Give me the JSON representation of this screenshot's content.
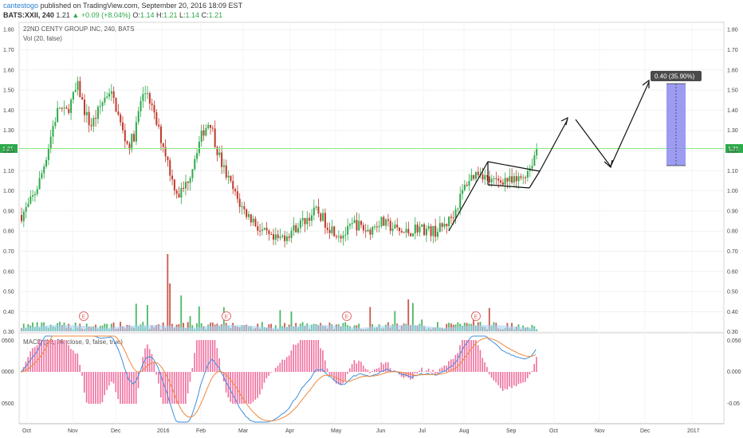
{
  "header": {
    "user": "cantestogo",
    "published": "published on TradingView.com, September 20, 2016 18:09 EST",
    "symbol": "BATS:XXII, 240",
    "last": "1.21",
    "change": "+0.09 (+8.04%)",
    "o_label": "O:",
    "o_value": "1.14",
    "h_label": "H:",
    "h_value": "1.21",
    "l_label": "L:",
    "l_value": "1.14",
    "c_label": "C:",
    "c_value": "1.21"
  },
  "legend": {
    "title": "22ND CENTY GROUP INC, 240, BATS",
    "vol": "Vol (20, false)",
    "macd": "MACD (12, 26, close, 9, false, true)"
  },
  "price_axis": {
    "ticks": [
      "1.80",
      "1.70",
      "1.60",
      "1.50",
      "1.40",
      "1.30",
      "1.20",
      "1.10",
      "1.00",
      "0.90",
      "0.80",
      "0.70",
      "0.60",
      "0.50",
      "0.40",
      "0.30"
    ],
    "current": "1.21"
  },
  "macd_axis": {
    "left_ticks": [
      "0500",
      "0000",
      "0500"
    ],
    "right_ticks": [
      "0.050",
      "0.000",
      "-0.05"
    ]
  },
  "time_axis": [
    "Oct",
    "Nov",
    "Dec",
    "2016",
    "Feb",
    "Mar",
    "Apr",
    "May",
    "Jun",
    "Jul",
    "Aug",
    "Sep",
    "Oct",
    "Nov",
    "Dec",
    "2017"
  ],
  "measure_label": "0.40 (35.90%)",
  "event_marker": "E",
  "colors": {
    "up": "#2eaa4a",
    "down": "#c0392b",
    "price_line": "#88e888",
    "measure_fill": "#8b8bf0",
    "macd_line": "#3d8fe0",
    "signal_line": "#f0883a",
    "histogram": "#f06e9e",
    "volume_ma": "#a9d3f5"
  },
  "chart_data": {
    "type": "candlestick",
    "price_range": [
      0.3,
      1.8
    ],
    "current_price": 1.21,
    "closes": [
      0.88,
      0.92,
      0.98,
      1.06,
      1.18,
      1.32,
      1.42,
      1.38,
      1.45,
      1.52,
      1.4,
      1.32,
      1.38,
      1.45,
      1.5,
      1.42,
      1.3,
      1.22,
      1.28,
      1.45,
      1.5,
      1.38,
      1.28,
      1.18,
      1.05,
      0.98,
      1.02,
      1.1,
      1.22,
      1.3,
      1.35,
      1.22,
      1.12,
      1.05,
      0.98,
      0.92,
      0.88,
      0.85,
      0.8,
      0.78,
      0.75,
      0.76,
      0.78,
      0.8,
      0.83,
      0.85,
      0.88,
      0.9,
      0.86,
      0.82,
      0.8,
      0.78,
      0.8,
      0.84,
      0.82,
      0.8,
      0.82,
      0.85,
      0.83,
      0.82,
      0.8,
      0.79,
      0.8,
      0.82,
      0.81,
      0.8,
      0.8,
      0.82,
      0.85,
      0.9,
      0.98,
      1.05,
      1.08,
      1.1,
      1.06,
      1.04,
      1.05,
      1.06,
      1.04,
      1.05,
      1.08,
      1.12,
      1.21
    ],
    "annotations": {
      "measure": {
        "from": 1.13,
        "to": 1.53,
        "label": "0.40 (35.90%)"
      }
    }
  }
}
